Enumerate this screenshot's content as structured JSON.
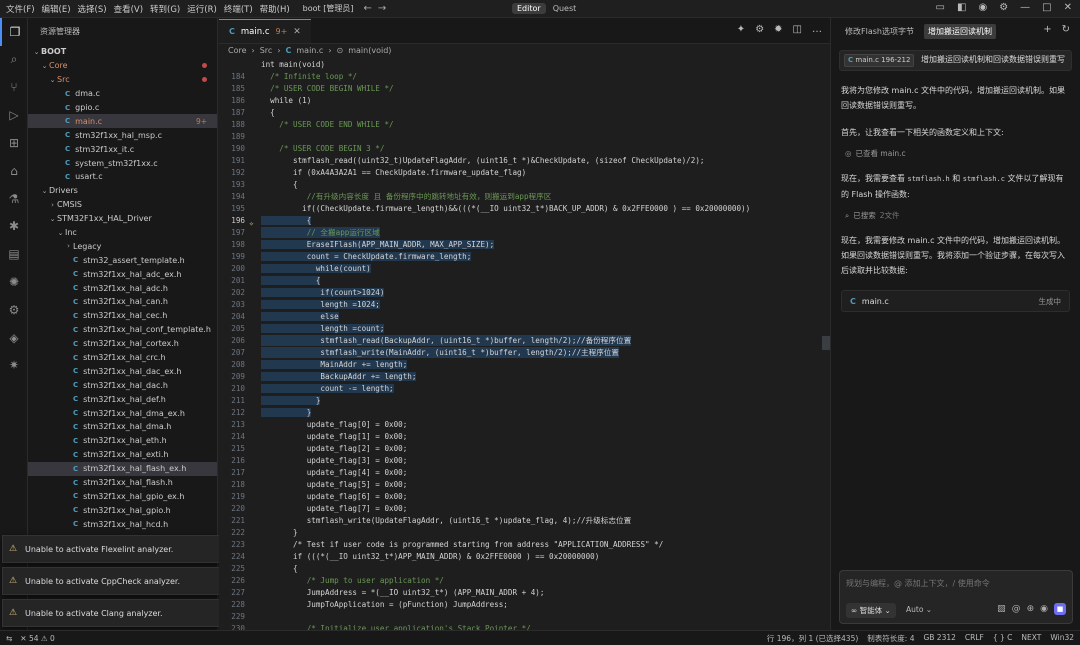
{
  "titlebar": {
    "menu": [
      "文件(F)",
      "编辑(E)",
      "选择(S)",
      "查看(V)",
      "转到(G)",
      "运行(R)",
      "终端(T)",
      "帮助(H)"
    ],
    "project": "boot [管理员]",
    "mode_editor": "Editor",
    "mode_quest": "Quest"
  },
  "explorer": {
    "title": "资源管理器",
    "items": [
      {
        "label": "BOOT",
        "depth": 0,
        "chev": "⌄",
        "bold": true
      },
      {
        "label": "Core",
        "depth": 1,
        "chev": "⌄",
        "orange": true,
        "dot": true
      },
      {
        "label": "Src",
        "depth": 2,
        "chev": "⌄",
        "orange": true,
        "dot": true
      },
      {
        "label": "dma.c",
        "depth": 3,
        "icon": "C"
      },
      {
        "label": "gpio.c",
        "depth": 3,
        "icon": "C"
      },
      {
        "label": "main.c",
        "depth": 3,
        "icon": "C",
        "orange": true,
        "badge": "9+",
        "sel": true
      },
      {
        "label": "stm32f1xx_hal_msp.c",
        "depth": 3,
        "icon": "C"
      },
      {
        "label": "stm32f1xx_it.c",
        "depth": 3,
        "icon": "C"
      },
      {
        "label": "system_stm32f1xx.c",
        "depth": 3,
        "icon": "C"
      },
      {
        "label": "usart.c",
        "depth": 3,
        "icon": "C"
      },
      {
        "label": "Drivers",
        "depth": 1,
        "chev": "⌄"
      },
      {
        "label": "CMSIS",
        "depth": 2,
        "chev": "›"
      },
      {
        "label": "STM32F1xx_HAL_Driver",
        "depth": 2,
        "chev": "⌄"
      },
      {
        "label": "Inc",
        "depth": 3,
        "chev": "⌄"
      },
      {
        "label": "Legacy",
        "depth": 4,
        "chev": "›"
      },
      {
        "label": "stm32_assert_template.h",
        "depth": 4,
        "icon": "C"
      },
      {
        "label": "stm32f1xx_hal_adc_ex.h",
        "depth": 4,
        "icon": "C"
      },
      {
        "label": "stm32f1xx_hal_adc.h",
        "depth": 4,
        "icon": "C"
      },
      {
        "label": "stm32f1xx_hal_can.h",
        "depth": 4,
        "icon": "C"
      },
      {
        "label": "stm32f1xx_hal_cec.h",
        "depth": 4,
        "icon": "C"
      },
      {
        "label": "stm32f1xx_hal_conf_template.h",
        "depth": 4,
        "icon": "C"
      },
      {
        "label": "stm32f1xx_hal_cortex.h",
        "depth": 4,
        "icon": "C"
      },
      {
        "label": "stm32f1xx_hal_crc.h",
        "depth": 4,
        "icon": "C"
      },
      {
        "label": "stm32f1xx_hal_dac_ex.h",
        "depth": 4,
        "icon": "C"
      },
      {
        "label": "stm32f1xx_hal_dac.h",
        "depth": 4,
        "icon": "C"
      },
      {
        "label": "stm32f1xx_hal_def.h",
        "depth": 4,
        "icon": "C"
      },
      {
        "label": "stm32f1xx_hal_dma_ex.h",
        "depth": 4,
        "icon": "C"
      },
      {
        "label": "stm32f1xx_hal_dma.h",
        "depth": 4,
        "icon": "C"
      },
      {
        "label": "stm32f1xx_hal_eth.h",
        "depth": 4,
        "icon": "C"
      },
      {
        "label": "stm32f1xx_hal_exti.h",
        "depth": 4,
        "icon": "C"
      },
      {
        "label": "stm32f1xx_hal_flash_ex.h",
        "depth": 4,
        "icon": "C",
        "sel": true
      },
      {
        "label": "stm32f1xx_hal_flash.h",
        "depth": 4,
        "icon": "C"
      },
      {
        "label": "stm32f1xx_hal_gpio_ex.h",
        "depth": 4,
        "icon": "C"
      },
      {
        "label": "stm32f1xx_hal_gpio.h",
        "depth": 4,
        "icon": "C"
      },
      {
        "label": "stm32f1xx_hal_hcd.h",
        "depth": 4,
        "icon": "C"
      }
    ]
  },
  "notifications": [
    "Unable to activate Flexelint analyzer.",
    "Unable to activate CppCheck analyzer.",
    "Unable to activate Clang analyzer."
  ],
  "editor": {
    "tab_label": "main.c",
    "tab_badge": "9+",
    "breadcrumb": [
      "Core",
      "Src",
      "main.c",
      "main(void)"
    ],
    "header_line": "int main(void)",
    "lines": [
      {
        "n": "184",
        "t": "  /* Infinite loop */",
        "cm": true
      },
      {
        "n": "185",
        "t": "  /* USER CODE BEGIN WHILE */",
        "cm": true
      },
      {
        "n": "186",
        "t": "  while (1)"
      },
      {
        "n": "187",
        "t": "  {"
      },
      {
        "n": "188",
        "t": "    /* USER CODE END WHILE */",
        "cm": true
      },
      {
        "n": "189",
        "t": ""
      },
      {
        "n": "190",
        "t": "    /* USER CODE BEGIN 3 */",
        "cm": true
      },
      {
        "n": "191",
        "t": "       stmflash_read((uint32_t)UpdateFlagAddr, (uint16_t *)&CheckUpdate, (sizeof CheckUpdate)/2);"
      },
      {
        "n": "192",
        "t": "       if (0xA4A3A2A1 == CheckUpdate.firmware_update_flag)"
      },
      {
        "n": "193",
        "t": "       {"
      },
      {
        "n": "194",
        "t": "          //有升级内容长度 且 备份程序中的跳转地址有效，则搬运到app程序区",
        "cm": true
      },
      {
        "n": "195",
        "t": "         if((CheckUpdate.firmware_length)&&(((*(__IO uint32_t*)BACK_UP_ADDR) & 0x2FFE0000 ) == 0x20000000))"
      },
      {
        "n": "196",
        "t": "          {",
        "hl": true,
        "bulb": true,
        "cur": true
      },
      {
        "n": "197",
        "t": "          // 全搬app运行区域",
        "cm": true,
        "hl": true
      },
      {
        "n": "198",
        "t": "          EraseIFlash(APP_MAIN_ADDR, MAX_APP_SIZE);",
        "hl": true
      },
      {
        "n": "199",
        "t": "          count = CheckUpdate.firmware_length;",
        "hl": true
      },
      {
        "n": "200",
        "t": "            while(count)",
        "hl": true
      },
      {
        "n": "201",
        "t": "            {",
        "hl": true
      },
      {
        "n": "202",
        "t": "             if(count>1024)",
        "hl": true
      },
      {
        "n": "203",
        "t": "             length =1024;",
        "hl": true
      },
      {
        "n": "204",
        "t": "             else",
        "hl": true
      },
      {
        "n": "205",
        "t": "             length =count;",
        "hl": true
      },
      {
        "n": "206",
        "t": "             stmflash_read(BackupAddr, (uint16_t *)buffer, length/2);//备份程序位置",
        "hl": true
      },
      {
        "n": "207",
        "t": "             stmflash_write(MainAddr, (uint16_t *)buffer, length/2);//主程序位置",
        "hl": true
      },
      {
        "n": "208",
        "t": "             MainAddr += length;",
        "hl": true
      },
      {
        "n": "209",
        "t": "             BackupAddr += length;",
        "hl": true
      },
      {
        "n": "210",
        "t": "             count -= length;",
        "hl": true
      },
      {
        "n": "211",
        "t": "            }",
        "hl": true
      },
      {
        "n": "212",
        "t": "          }",
        "hl": true
      },
      {
        "n": "213",
        "t": "          update_flag[0] = 0x00;"
      },
      {
        "n": "214",
        "t": "          update_flag[1] = 0x00;"
      },
      {
        "n": "215",
        "t": "          update_flag[2] = 0x00;"
      },
      {
        "n": "216",
        "t": "          update_flag[3] = 0x00;"
      },
      {
        "n": "217",
        "t": "          update_flag[4] = 0x00;"
      },
      {
        "n": "218",
        "t": "          update_flag[5] = 0x00;"
      },
      {
        "n": "219",
        "t": "          update_flag[6] = 0x00;"
      },
      {
        "n": "220",
        "t": "          update_flag[7] = 0x00;"
      },
      {
        "n": "221",
        "t": "          stmflash_write(UpdateFlagAddr, (uint16_t *)update_flag, 4);//升级标志位置"
      },
      {
        "n": "222",
        "t": "       }"
      },
      {
        "n": "223",
        "t": "       /* Test if user code is programmed starting from address \"APPLICATION_ADDRESS\" */"
      },
      {
        "n": "224",
        "t": "       if (((*(__IO uint32_t*)APP_MAIN_ADDR) & 0x2FFE0000 ) == 0x20000000)"
      },
      {
        "n": "225",
        "t": "       {"
      },
      {
        "n": "226",
        "t": "          /* Jump to user application */",
        "cm": true
      },
      {
        "n": "227",
        "t": "          JumpAddress = *(__IO uint32_t*) (APP_MAIN_ADDR + 4);"
      },
      {
        "n": "228",
        "t": "          JumpToApplication = (pFunction) JumpAddress;"
      },
      {
        "n": "229",
        "t": ""
      },
      {
        "n": "230",
        "t": "          /* Initialize user application's Stack Pointer */",
        "cm": true
      }
    ]
  },
  "ai_panel": {
    "tab1": "修改Flash选项字节",
    "tab2": "增加搬运回读机制",
    "query_chip": "main.c 196-212",
    "query_text": "增加搬运回读机制和回读数据错误则重写",
    "p1": "我将为您修改 main.c 文件中的代码，增加搬运回读机制。如果回读数据错误则重写。",
    "p2": "首先，让我查看一下相关的函数定义和上下文:",
    "meta1": "已查看 main.c",
    "p3a": "现在，我需要查看 ",
    "p3b": "stmflash.h",
    "p3c": " 和 ",
    "p3d": "stmflash.c",
    "p3e": " 文件以了解现有的 Flash 操作函数:",
    "meta2a": "已搜索",
    "meta2b": "2文件",
    "p4": "现在，我需要修改 main.c 文件中的代码，增加搬运回读机制。如果回读数据错误则重写。我将添加一个验证步骤，在每次写入后读取并比较数据:",
    "gen_file": "main.c",
    "gen_status": "生成中",
    "input_placeholder": "规划与编程，@ 添加上下文，/ 使用命令",
    "agent": "智能体",
    "auto": "Auto"
  },
  "statusbar": {
    "left_icon": "✕",
    "errors": "54",
    "warnings": "0",
    "items": [
      "行 196，列 1 (已选择435)",
      "制表符长度: 4",
      "GB 2312",
      "CRLF",
      "{ } C",
      "NEXT",
      "Win32"
    ]
  }
}
